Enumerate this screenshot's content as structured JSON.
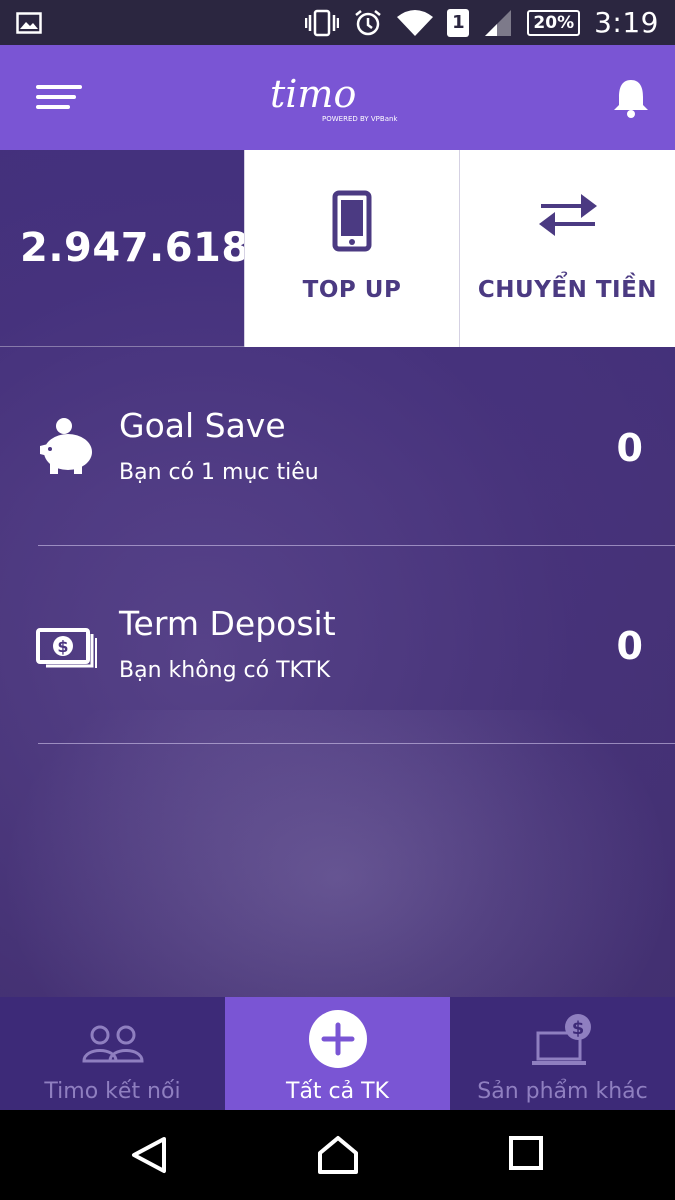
{
  "status_bar": {
    "battery": "20%",
    "sim": "1",
    "time": "3:19",
    "icons": [
      "gallery-icon",
      "vibrate-icon",
      "alarm-icon",
      "wifi-icon",
      "sim-icon",
      "signal-icon",
      "battery-icon"
    ]
  },
  "header": {
    "logo_text": "timo",
    "logo_tagline": "POWERED BY VPBank",
    "icons": [
      "menu-icon",
      "bell-icon"
    ]
  },
  "balance": {
    "amount": "2.947.618"
  },
  "actions": [
    {
      "label": "TOP UP",
      "icon": "phone-icon"
    },
    {
      "label": "CHUYỂN TIỀN",
      "icon": "transfer-arrows-icon"
    }
  ],
  "accounts": [
    {
      "title": "Goal Save",
      "subtitle": "Bạn có 1 mục tiêu",
      "value": "0",
      "icon": "piggy-bank-icon"
    },
    {
      "title": "Term Deposit",
      "subtitle": "Bạn không có TKTK",
      "value": "0",
      "icon": "cash-stack-icon"
    }
  ],
  "bottom_nav": [
    {
      "label": "Timo kết nối",
      "icon": "people-icon",
      "active": false
    },
    {
      "label": "Tất cả TK",
      "icon": "plus-circle-icon",
      "active": true
    },
    {
      "label": "Sản phẩm khác",
      "icon": "laptop-dollar-icon",
      "active": false
    }
  ],
  "colors": {
    "primary": "#7a55d4",
    "nav_dark": "#3d2a78",
    "status_bar": "#2b2640",
    "tile_text": "#4b3a82"
  }
}
